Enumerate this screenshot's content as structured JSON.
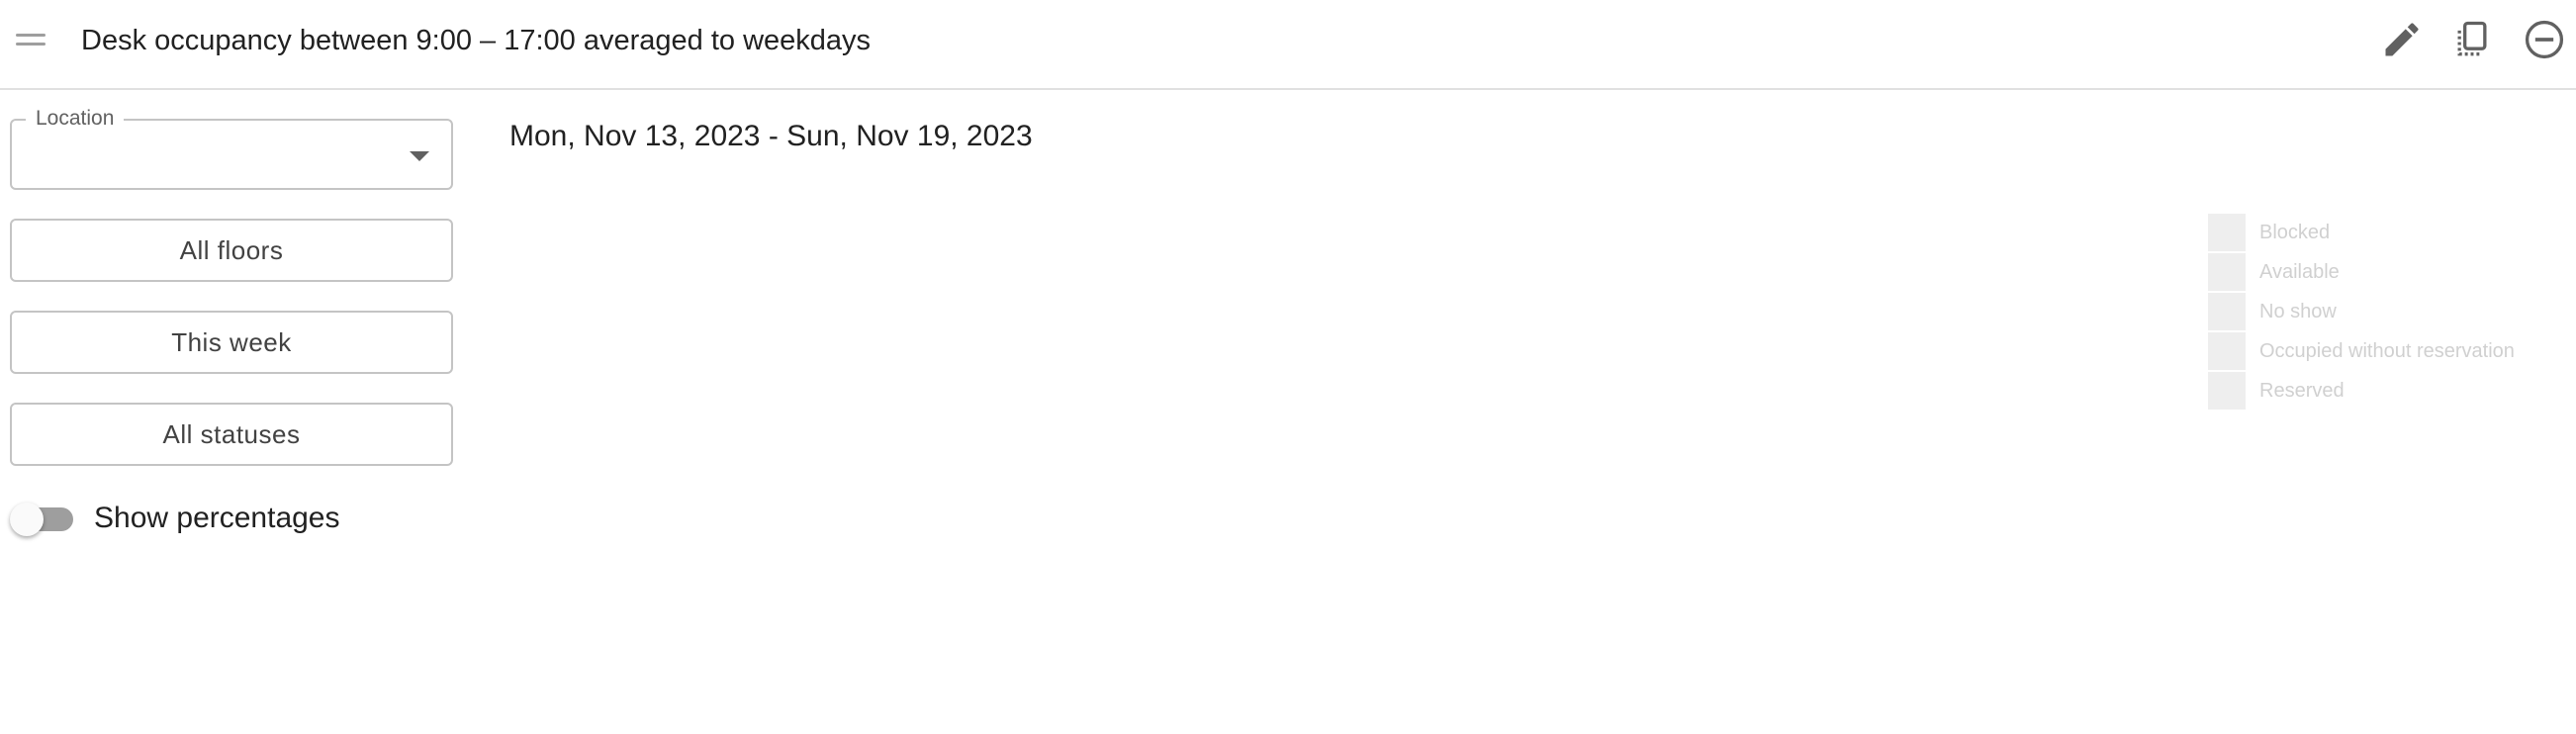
{
  "header": {
    "title": "Desk occupancy between 9:00 – 17:00 averaged to weekdays",
    "icons": [
      "drag-handle-icon",
      "edit-icon",
      "copy-icon",
      "remove-icon"
    ]
  },
  "filters": {
    "location": {
      "label": "Location",
      "value": ""
    },
    "floors_label": "All floors",
    "week_label": "This week",
    "statuses_label": "All statuses",
    "show_percentages": {
      "label": "Show percentages",
      "enabled": false
    }
  },
  "main": {
    "date_range": "Mon, Nov 13, 2023 - Sun, Nov 19, 2023"
  },
  "legend": {
    "items": [
      {
        "label": "Blocked"
      },
      {
        "label": "Available"
      },
      {
        "label": "No show"
      },
      {
        "label": "Occupied without reservation"
      },
      {
        "label": "Reserved"
      }
    ]
  },
  "colors": {
    "border": "#c4c4c4",
    "legend_swatch": "#eeeeee",
    "toggle_track": "#9e9e9e"
  }
}
